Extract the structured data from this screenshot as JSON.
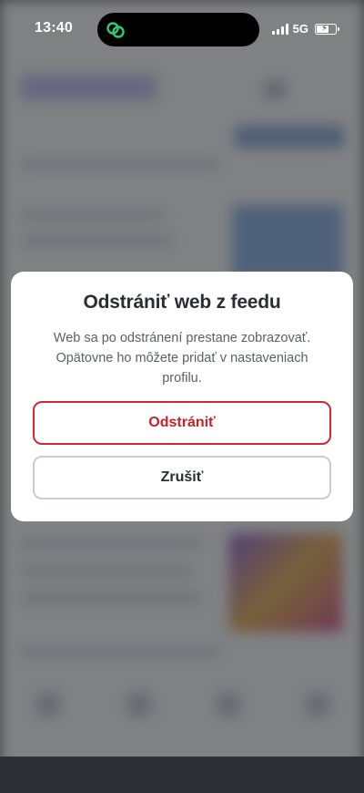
{
  "status_bar": {
    "time": "13:40",
    "network": "5G",
    "battery_level": 0.7,
    "island_icon": "linked-rings-icon"
  },
  "dialog": {
    "title": "Odstrániť web z feedu",
    "message": "Web sa po odstránení prestane zobrazovať. Opätovne ho môžete pridať v nastaveniach profilu.",
    "primary_label": "Odstrániť",
    "secondary_label": "Zrušiť"
  },
  "colors": {
    "accent_red": "#d4262e",
    "island_icon_green": "#2ecc71",
    "dialog_bg": "#ffffff",
    "title_text": "#2a2d33",
    "secondary_border": "#c8ccd4"
  }
}
